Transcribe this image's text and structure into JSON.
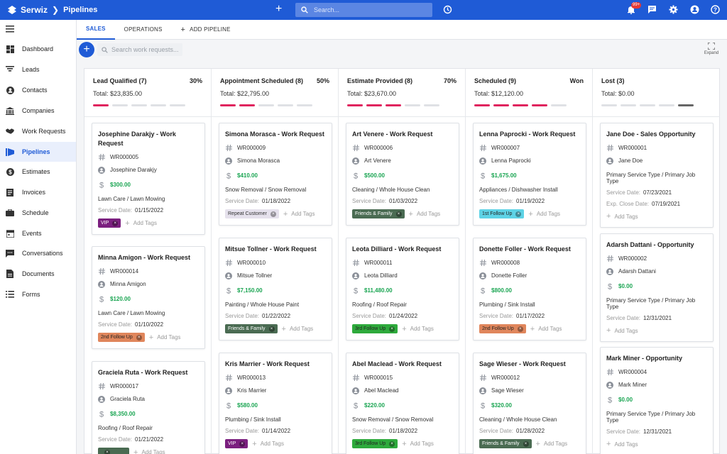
{
  "app": {
    "brand": "Serwiz",
    "section": "Pipelines",
    "search_placeholder": "Search...",
    "notifications_badge": "99+"
  },
  "sidebar": {
    "items": [
      {
        "label": "Dashboard",
        "icon": "dashboard-icon"
      },
      {
        "label": "Leads",
        "icon": "filter-icon"
      },
      {
        "label": "Contacts",
        "icon": "person-icon"
      },
      {
        "label": "Companies",
        "icon": "bank-icon"
      },
      {
        "label": "Work Requests",
        "icon": "handshake-icon"
      },
      {
        "label": "Pipelines",
        "icon": "pipeline-icon"
      },
      {
        "label": "Estimates",
        "icon": "dollar-icon"
      },
      {
        "label": "Invoices",
        "icon": "invoice-icon"
      },
      {
        "label": "Schedule",
        "icon": "briefcase-icon"
      },
      {
        "label": "Events",
        "icon": "calendar-icon"
      },
      {
        "label": "Conversations",
        "icon": "chat-icon"
      },
      {
        "label": "Documents",
        "icon": "document-icon"
      },
      {
        "label": "Forms",
        "icon": "list-icon"
      }
    ]
  },
  "tabs": {
    "sales": "SALES",
    "operations": "OPERATIONS",
    "add_pipeline": "ADD PIPELINE"
  },
  "toolbar": {
    "search_placeholder": "Search work requests...",
    "expand": "Expand"
  },
  "labels": {
    "service_date": "Service Date:",
    "exp_close_date": "Exp. Close Date:",
    "add_tags": "Add Tags",
    "total": "Total:"
  },
  "columns": [
    {
      "title": "Lead Qualified (7)",
      "pct": "30%",
      "total": "$23,835.00",
      "progress_on": 1,
      "cards": [
        {
          "title": "Josephine Darakjy - Work Request",
          "id": "WR000005",
          "person": "Josephine Darakjy",
          "amount": "$300.00",
          "type": "Lawn Care / Lawn Mowing",
          "date": "01/15/2022",
          "tag": "VIP",
          "tag_color": "#7b1f7f",
          "tag_text": "#ffffff"
        },
        {
          "title": "Minna Amigon - Work Request",
          "id": "WR000014",
          "person": "Minna Amigon",
          "amount": "$120.00",
          "type": "Lawn Care / Lawn Mowing",
          "date": "01/10/2022",
          "tag": "2nd Follow Up",
          "tag_color": "#e0865c",
          "tag_text": "#222222"
        },
        {
          "title": "Graciela Ruta - Work Request",
          "id": "WR000017",
          "person": "Graciela Ruta",
          "amount": "$8,350.00",
          "type": "Roofing / Roof Repair",
          "date": "01/21/2022",
          "tag": "",
          "tag_color": "#4a6b52",
          "tag_text": "#ffffff"
        }
      ]
    },
    {
      "title": "Appointment Scheduled (8)",
      "pct": "50%",
      "total": "$22,795.00",
      "progress_on": 2,
      "cards": [
        {
          "title": "Simona Morasca - Work Request",
          "id": "WR000009",
          "person": "Simona Morasca",
          "amount": "$410.00",
          "type": "Snow Removal / Snow Removal",
          "date": "01/18/2022",
          "tag": "Repeat Customer",
          "tag_color": "#e5e1ec",
          "tag_text": "#333333"
        },
        {
          "title": "Mitsue Tollner - Work Request",
          "id": "WR000010",
          "person": "Mitsue Tollner",
          "amount": "$7,150.00",
          "type": "Painting / Whole House Paint",
          "date": "01/22/2022",
          "tag": "Friends & Family",
          "tag_color": "#4a6b52",
          "tag_text": "#ffffff"
        },
        {
          "title": "Kris Marrier - Work Request",
          "id": "WR000013",
          "person": "Kris Marrier",
          "amount": "$580.00",
          "type": "Plumbing / Sink Install",
          "date": "01/14/2022",
          "tag": "VIP",
          "tag_color": "#7b1f7f",
          "tag_text": "#ffffff"
        }
      ]
    },
    {
      "title": "Estimate Provided (8)",
      "pct": "70%",
      "total": "$23,670.00",
      "progress_on": 3,
      "cards": [
        {
          "title": "Art Venere - Work Request",
          "id": "WR000006",
          "person": "Art Venere",
          "amount": "$500.00",
          "type": "Cleaning / Whole House Clean",
          "date": "01/03/2022",
          "tag": "Friends & Family",
          "tag_color": "#4a6b52",
          "tag_text": "#ffffff"
        },
        {
          "title": "Leota Dilliard - Work Request",
          "id": "WR000011",
          "person": "Leota Dilliard",
          "amount": "$11,480.00",
          "type": "Roofing / Roof Repair",
          "date": "01/24/2022",
          "tag": "3rd Follow Up",
          "tag_color": "#2eaa3c",
          "tag_text": "#222222"
        },
        {
          "title": "Abel Maclead - Work Request",
          "id": "WR000015",
          "person": "Abel Maclead",
          "amount": "$220.00",
          "type": "Snow Removal / Snow Removal",
          "date": "01/18/2022",
          "tag": "3rd Follow Up",
          "tag_color": "#2eaa3c",
          "tag_text": "#222222"
        }
      ]
    },
    {
      "title": "Scheduled (9)",
      "pct": "Won",
      "total": "$12,120.00",
      "progress_on": 4,
      "cards": [
        {
          "title": "Lenna Paprocki - Work Request",
          "id": "WR000007",
          "person": "Lenna Paprocki",
          "amount": "$1,675.00",
          "type": "Appliances / Dishwasher Install",
          "date": "01/19/2022",
          "tag": "1st Follow Up",
          "tag_color": "#5ed3e6",
          "tag_text": "#222222"
        },
        {
          "title": "Donette Foller - Work Request",
          "id": "WR000008",
          "person": "Donette Foller",
          "amount": "$800.00",
          "type": "Plumbing / Sink Install",
          "date": "01/17/2022",
          "tag": "2nd Follow Up",
          "tag_color": "#e0865c",
          "tag_text": "#222222"
        },
        {
          "title": "Sage Wieser - Work Request",
          "id": "WR000012",
          "person": "Sage Wieser",
          "amount": "$320.00",
          "type": "Cleaning / Whole House Clean",
          "date": "01/28/2022",
          "tag": "Friends & Family",
          "tag_color": "#4a6b52",
          "tag_text": "#ffffff"
        }
      ]
    },
    {
      "title": "Lost (3)",
      "pct": "",
      "total": "$0.00",
      "progress_on": 0,
      "cards": [
        {
          "title": "Jane Doe - Sales Opportunity",
          "id": "WR000001",
          "person": "Jane Doe",
          "amount": "",
          "type": "Primary Service Type / Primary Job Type",
          "date": "07/23/2021",
          "exp": "07/19/2021",
          "tag": ""
        },
        {
          "title": "Adarsh Dattani - Opportunity",
          "id": "WR000002",
          "person": "Adarsh Dattani",
          "amount": "$0.00",
          "type": "Primary Service Type / Primary Job Type",
          "date": "12/31/2021",
          "tag": ""
        },
        {
          "title": "Mark Miner - Opportunity",
          "id": "WR000004",
          "person": "Mark Miner",
          "amount": "$0.00",
          "type": "Primary Service Type / Primary Job Type",
          "date": "12/31/2021",
          "tag": ""
        }
      ]
    }
  ]
}
